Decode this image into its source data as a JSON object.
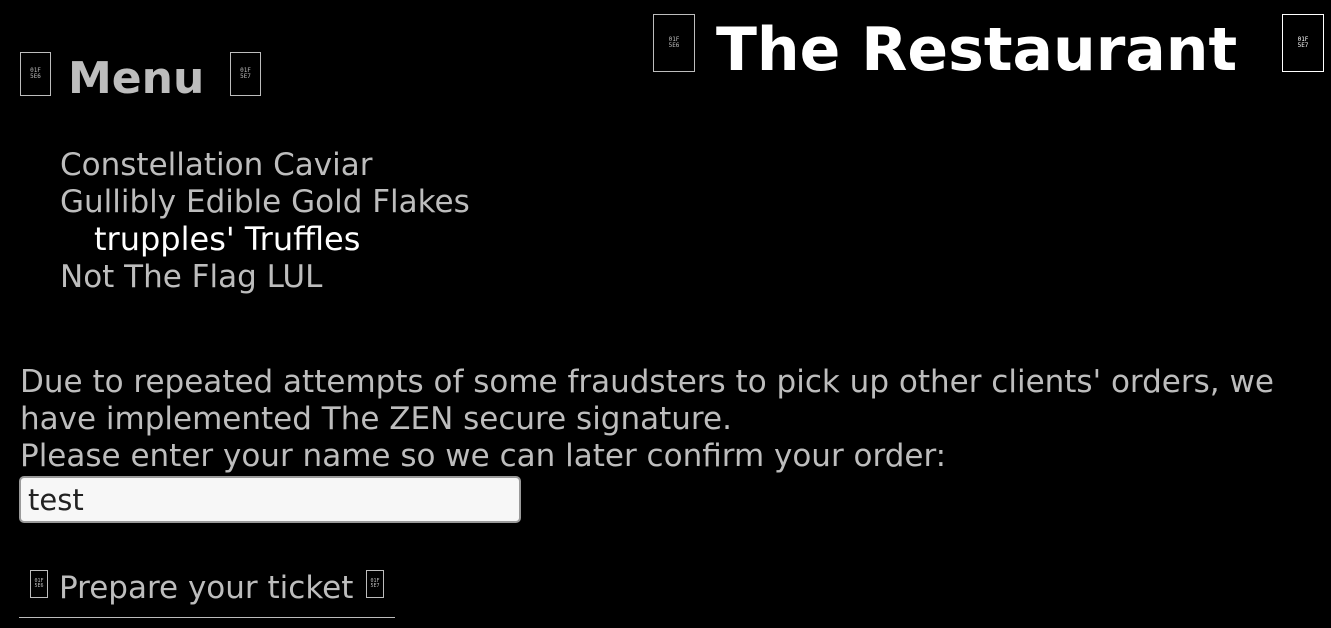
{
  "header": {
    "title": "The Restaurant",
    "left_glyph": "01F\n5E6",
    "right_glyph": "01F\n5E7"
  },
  "menu": {
    "heading": "Menu",
    "left_glyph": "01F\n5E6",
    "right_glyph": "01F\n5E7",
    "items": [
      {
        "label": "Constellation Caviar",
        "selected": false
      },
      {
        "label": "Gullibly Edible Gold Flakes",
        "selected": false
      },
      {
        "label": "trupples' Truffles",
        "selected": true
      },
      {
        "label": "Not The Flag LUL",
        "selected": false
      }
    ]
  },
  "notice": {
    "line1": "Due to repeated attempts of some fraudsters to pick up other clients' orders, we have implemented The ZEN secure signature.",
    "line2": "Please enter your name so we can later confirm your order:"
  },
  "name_input": {
    "value": "test"
  },
  "ticket_button": {
    "label": "Prepare your ticket",
    "left_glyph": "01F\n5E6",
    "right_glyph": "01F\n5E7"
  },
  "colors": {
    "background": "#000000",
    "text": "#bdbdbd",
    "highlight": "#ffffff"
  }
}
